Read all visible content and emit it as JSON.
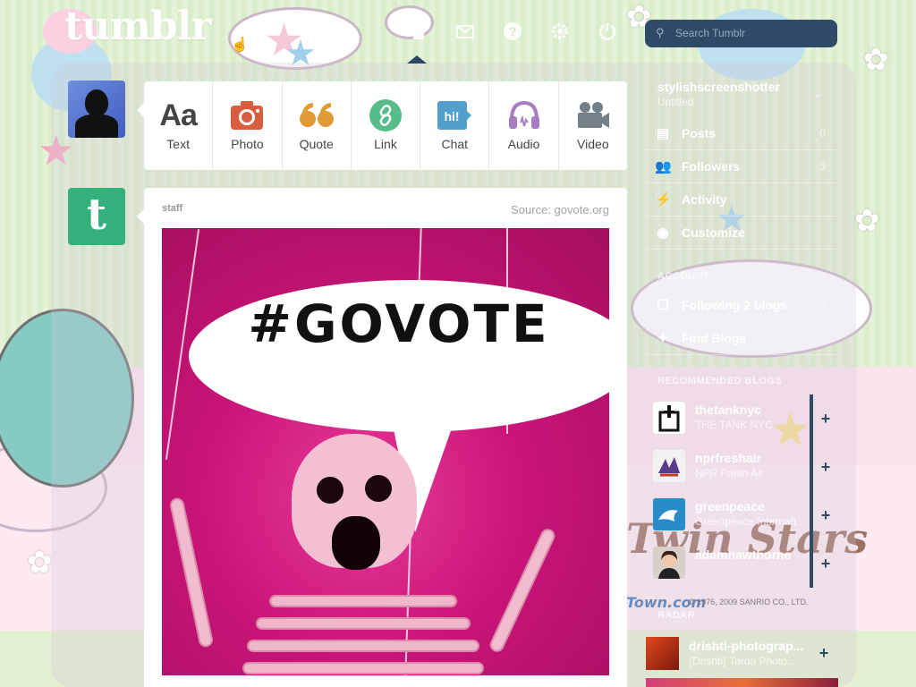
{
  "header": {
    "logo": "tumblr",
    "search_placeholder": "Search Tumblr",
    "nav_icons": [
      "home-icon",
      "mail-icon",
      "help-icon",
      "gear-icon",
      "power-icon"
    ]
  },
  "post_types": [
    {
      "label": "Text",
      "icon": "Aa",
      "color": "#444444"
    },
    {
      "label": "Photo",
      "icon": "camera-icon",
      "color": "#d95e40"
    },
    {
      "label": "Quote",
      "icon": "quote-icon",
      "color": "#e09b36"
    },
    {
      "label": "Link",
      "icon": "link-icon",
      "color": "#56bc8a"
    },
    {
      "label": "Chat",
      "icon": "hi!",
      "color": "#529ecc"
    },
    {
      "label": "Audio",
      "icon": "headphones-icon",
      "color": "#a77dc2"
    },
    {
      "label": "Video",
      "icon": "video-camera-icon",
      "color": "#748089"
    }
  ],
  "post": {
    "username": "staff",
    "source": "Source: govote.org",
    "image_text": "#GOVOTE"
  },
  "sidebar": {
    "blog_name": "stylishscreenshotter",
    "blog_subtitle": "Untitled",
    "items": [
      {
        "label": "Posts",
        "count": "0",
        "icon": "posts-icon"
      },
      {
        "label": "Followers",
        "count": "3",
        "icon": "followers-icon"
      },
      {
        "label": "Activity",
        "count": "",
        "icon": "activity-icon"
      },
      {
        "label": "Customize",
        "count": "",
        "icon": "eye-icon"
      }
    ],
    "account_heading": "ACCOUNT",
    "account_items": [
      {
        "label": "Following 2 blogs",
        "icon": "following-icon"
      },
      {
        "label": "Find Blogs",
        "icon": "find-icon"
      }
    ],
    "recommended_heading": "RECOMMENDED BLOGS",
    "recommended": [
      {
        "name": "thetanknyc",
        "desc": "THE TANK NYC"
      },
      {
        "name": "nprfreshair",
        "desc": "NPR Fresh Air"
      },
      {
        "name": "greenpeace",
        "desc": "Greenpeace Internati..."
      },
      {
        "name": "adamhawthorne",
        "desc": ""
      }
    ],
    "radar_heading": "RADAR",
    "radar_item": {
      "name": "drishti-photograp...",
      "desc": "{Drishti} Tarda Photo..."
    }
  },
  "watermark": {
    "title": "Twin Stars",
    "site": "Town.com",
    "copyright": "© 1976, 2009 SANRIO CO., LTD."
  }
}
